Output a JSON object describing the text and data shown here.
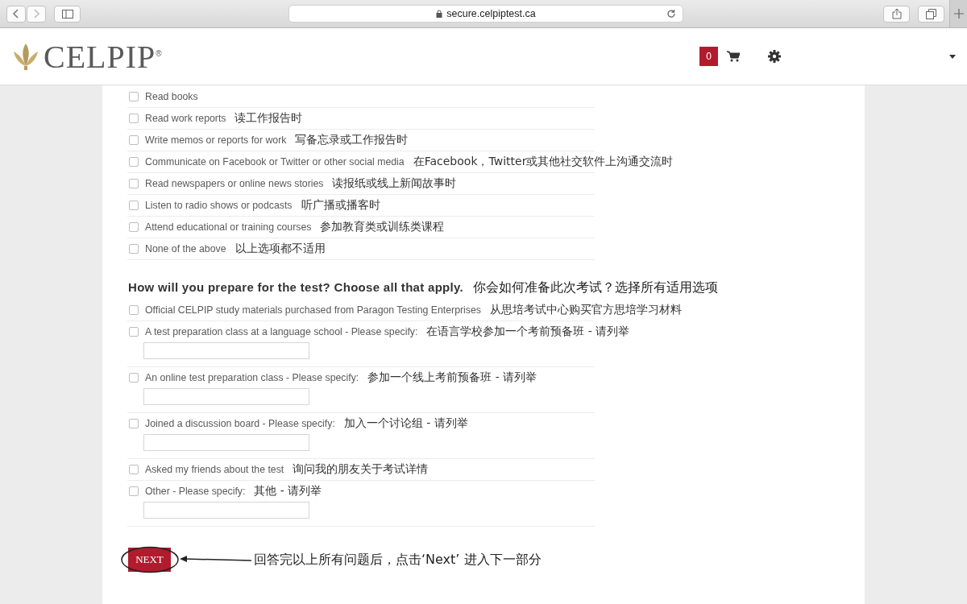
{
  "browser": {
    "url": "secure.celpiptest.ca"
  },
  "header": {
    "logo": "CELPIP",
    "logo_mark": "®",
    "cart_count": "0"
  },
  "activities": [
    {
      "label": "Read books",
      "checked": false
    },
    {
      "label": "Read work reports",
      "translation": "读工作报告时",
      "checked": false
    },
    {
      "label": "Write memos or reports for work",
      "translation": "写备忘录或工作报告时",
      "checked": false
    },
    {
      "label": "Communicate on Facebook or Twitter or other social media",
      "translation": "在Facebook，Twitter或其他社交软件上沟通交流时",
      "checked": false
    },
    {
      "label": "Read newspapers or online news stories",
      "translation": "读报纸或线上新闻故事时",
      "checked": false
    },
    {
      "label": "Listen to radio shows or podcasts",
      "translation": "听广播或播客时",
      "checked": false
    },
    {
      "label": "Attend educational or training courses",
      "translation": "参加教育类或训练类课程",
      "checked": false
    },
    {
      "label": "None of the above",
      "translation": "以上选项都不适用",
      "checked": false
    }
  ],
  "question": {
    "text": "How will you prepare for the test? Choose all that apply.",
    "translation": "你会如何准备此次考试？选择所有适用选项"
  },
  "preparation": [
    {
      "kind": "plain",
      "label": "Official CELPIP study materials purchased from Paragon Testing Enterprises",
      "translation": "从思培考试中心购买官方思培学习材料",
      "checked": false
    },
    {
      "kind": "specify",
      "label": "A test preparation class at a language school - Please specify:",
      "translation": "在语言学校参加一个考前预备班 - 请列举",
      "checked": false
    },
    {
      "kind": "specify",
      "label": "An online test preparation class - Please specify:",
      "translation": "参加一个线上考前预备班 - 请列举",
      "checked": false
    },
    {
      "kind": "specify",
      "label": "Joined a discussion board - Please specify:",
      "translation": "加入一个讨论组 - 请列举",
      "checked": false
    },
    {
      "kind": "plain",
      "label": "Asked my friends about the test",
      "translation": "询问我的朋友关于考试详情",
      "checked": false
    },
    {
      "kind": "specify",
      "label": "Other - Please specify:",
      "translation": "其他 - 请列举",
      "checked": false
    }
  ],
  "next_button": "NEXT",
  "annotation": "回答完以上所有问题后，点击‘Next’ 进入下一部分"
}
